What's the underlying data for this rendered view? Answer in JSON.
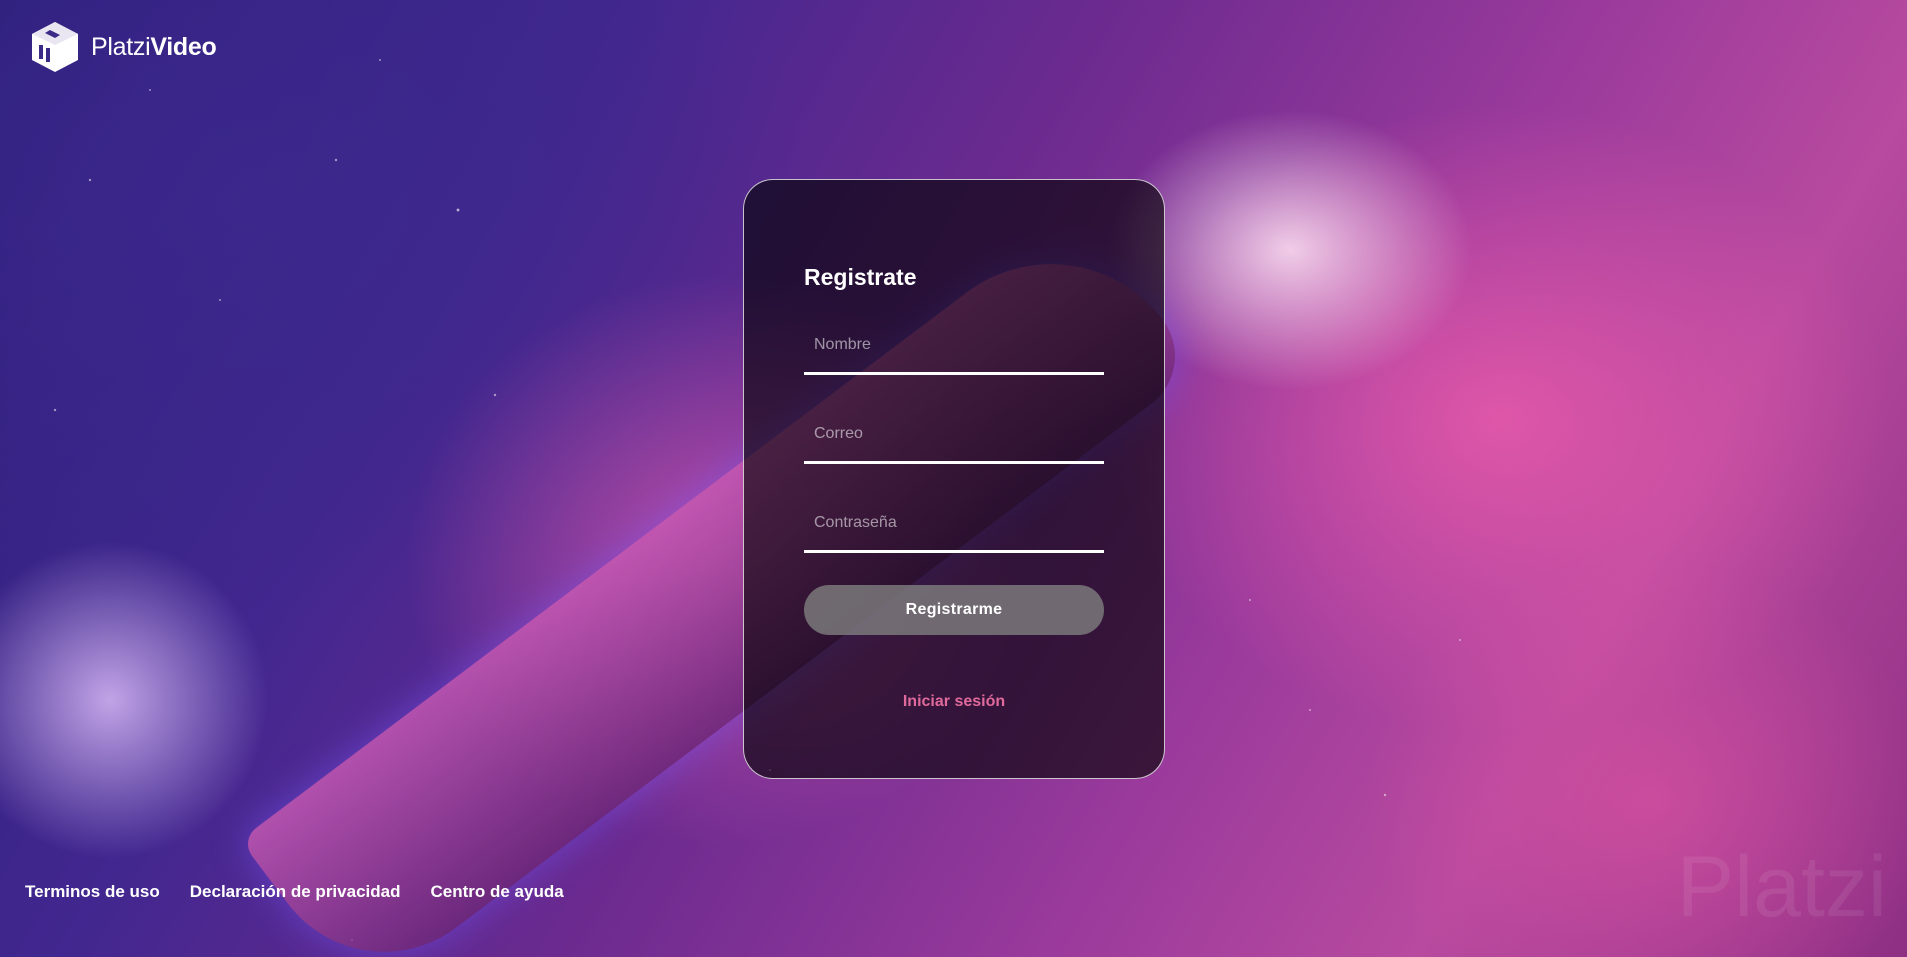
{
  "brand": {
    "name_light": "Platzi",
    "name_bold": "Video",
    "watermark": "Platzi"
  },
  "register": {
    "title": "Registrate",
    "name_placeholder": "Nombre",
    "email_placeholder": "Correo",
    "password_placeholder": "Contraseña",
    "submit_label": "Registrarme",
    "login_link": "Iniciar sesión"
  },
  "footer": {
    "links": [
      "Terminos de uso",
      "Declaración de privacidad",
      "Centro de ayuda"
    ]
  },
  "colors": {
    "link_accent": "#e06a9c",
    "button_bg": "#828282",
    "card_bg": "#000000"
  }
}
